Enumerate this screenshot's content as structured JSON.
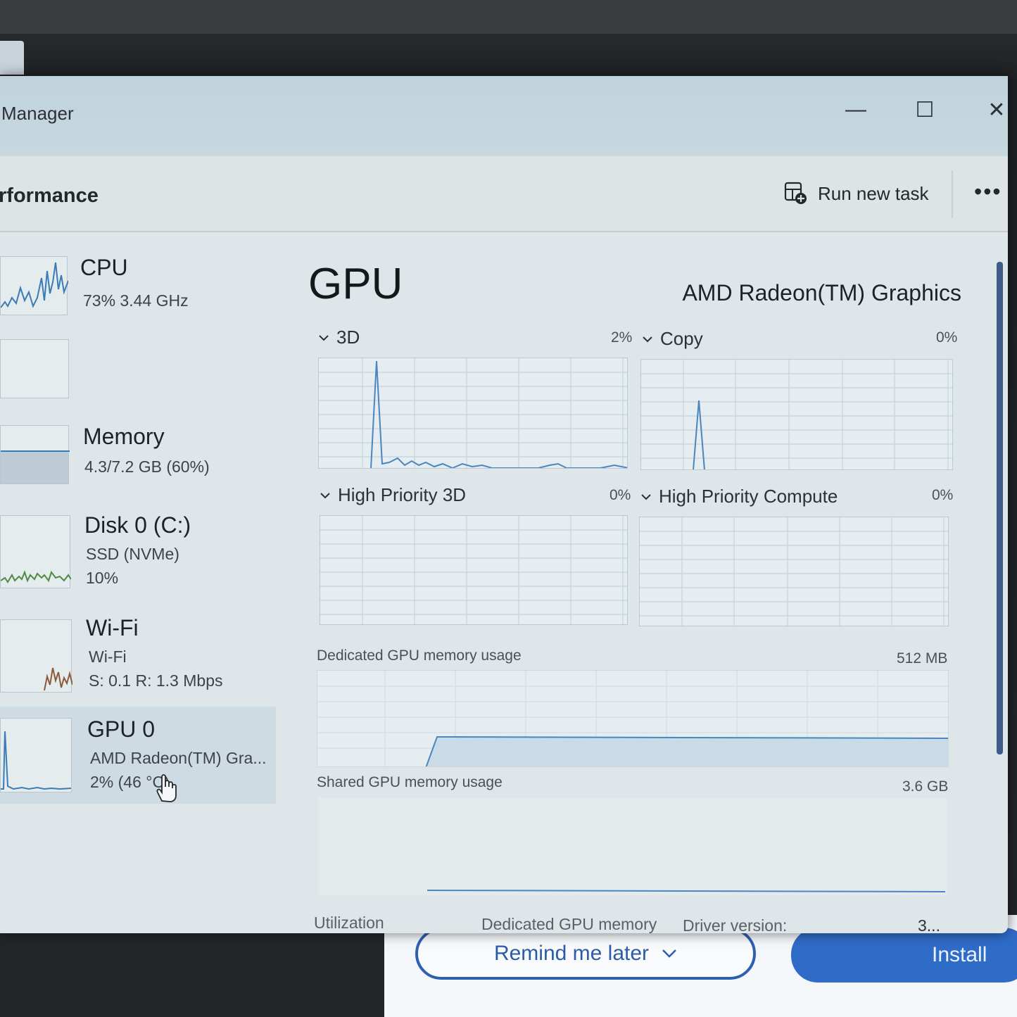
{
  "window": {
    "title": "Manager",
    "page_title": "rformance",
    "run_new_task_label": "Run new task",
    "more_label": "•••",
    "min_label": "—",
    "max_label": "☐",
    "close_label": "✕"
  },
  "sidebar": {
    "items": [
      {
        "name": "CPU",
        "line1": "73%  3.44 GHz",
        "line2": ""
      },
      {
        "name": "Memory",
        "line1": "4.3/7.2 GB (60%)",
        "line2": ""
      },
      {
        "name": "Disk 0 (C:)",
        "line1": "SSD (NVMe)",
        "line2": "10%"
      },
      {
        "name": "Wi-Fi",
        "line1": "Wi-Fi",
        "line2": "S: 0.1  R: 1.3 Mbps"
      },
      {
        "name": "GPU 0",
        "line1": "AMD Radeon(TM) Gra...",
        "line2": "2%  (46 °C)"
      }
    ],
    "selected_index": 4
  },
  "gpu": {
    "heading": "GPU",
    "model": "AMD Radeon(TM) Graphics",
    "engines": [
      {
        "label": "3D",
        "percent": "2%"
      },
      {
        "label": "Copy",
        "percent": "0%"
      },
      {
        "label": "High Priority 3D",
        "percent": "0%"
      },
      {
        "label": "High Priority Compute",
        "percent": "0%"
      }
    ],
    "dedicated_memory": {
      "label": "Dedicated GPU memory usage",
      "max": "512 MB"
    },
    "shared_memory": {
      "label": "Shared GPU memory usage",
      "max": "3.6 GB"
    },
    "stats": {
      "utilization_label": "Utilization",
      "dedicated_label": "Dedicated GPU memory",
      "driver_label": "Driver version:",
      "driver_value": "3..."
    }
  },
  "notification": {
    "remind_label": "Remind me later",
    "install_label": "Install"
  },
  "colors": {
    "graph_line": "#4a86c0",
    "graph_grid": "#c4d3dd",
    "accent": "#2f6cc8"
  }
}
